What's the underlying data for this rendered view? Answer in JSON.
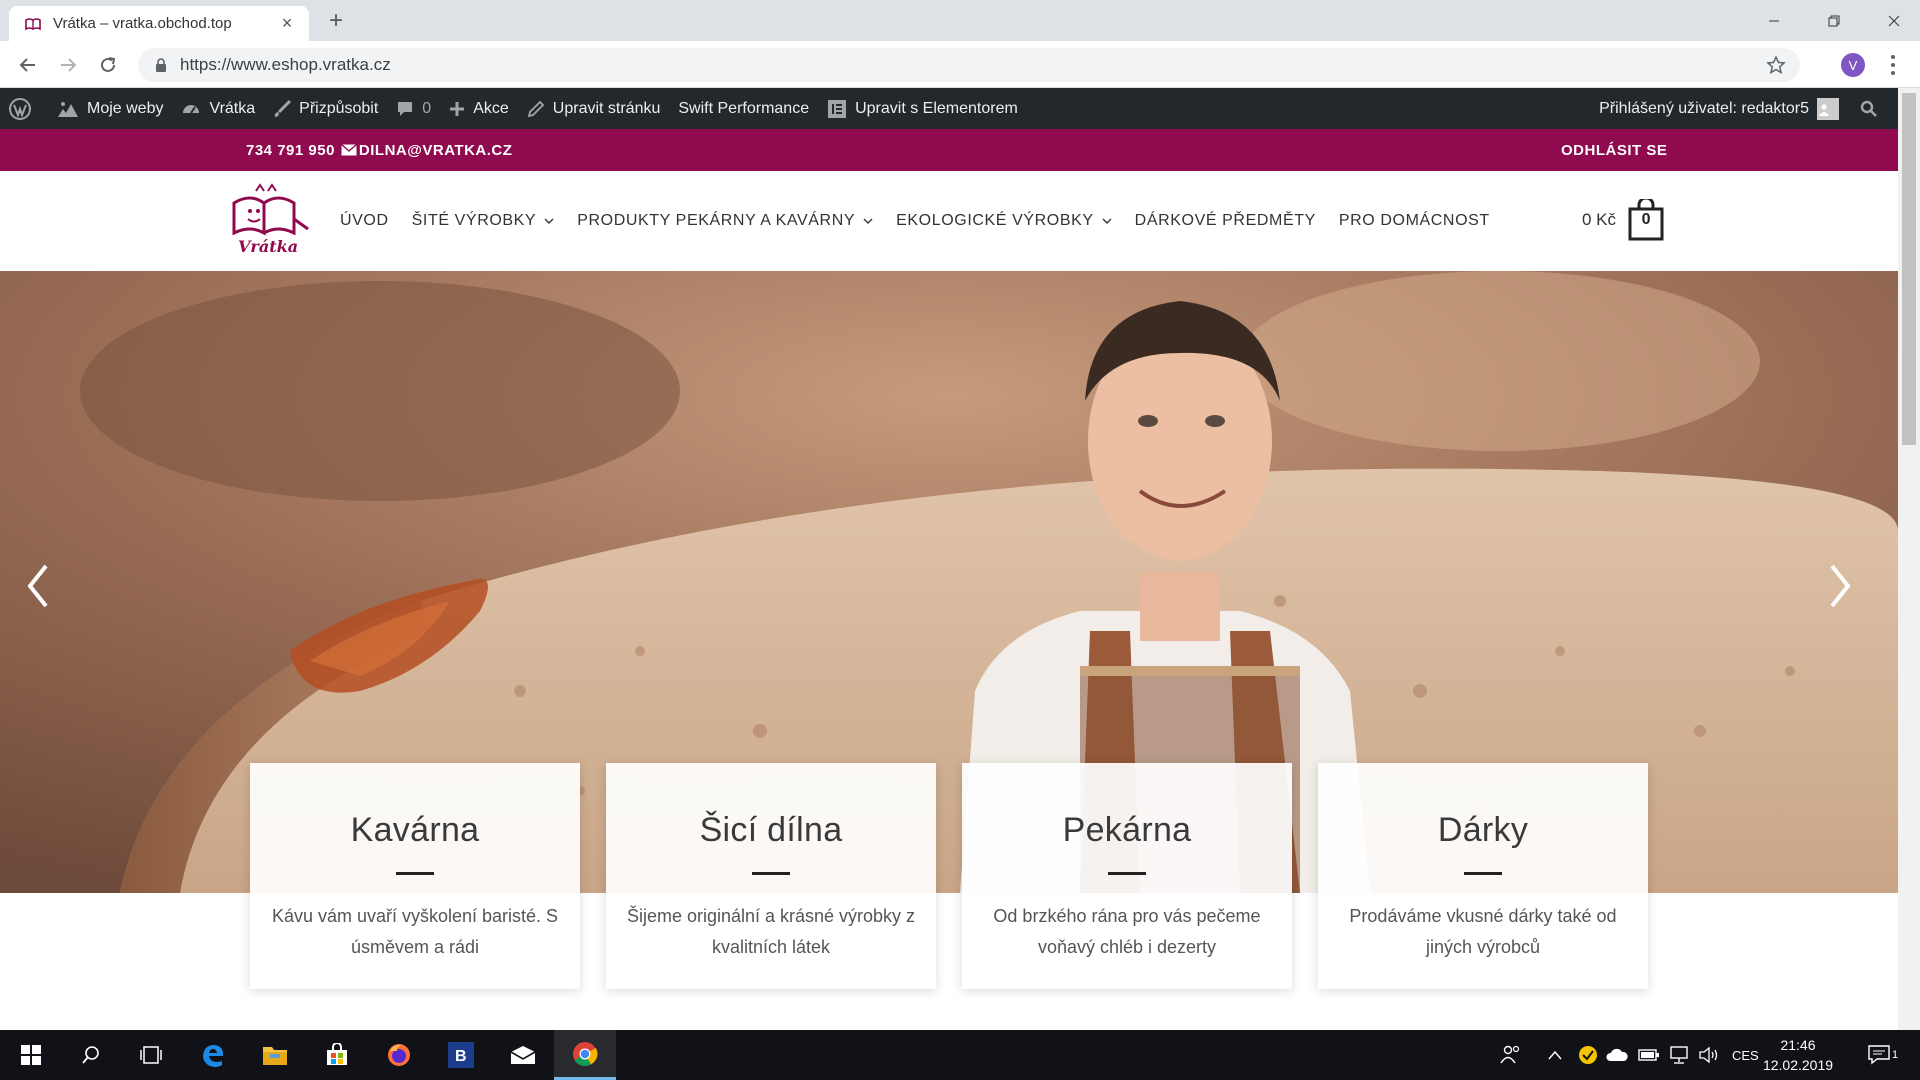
{
  "browser": {
    "tab_title": "Vrátka – vratka.obchod.top",
    "tab_close": "×",
    "new_tab": "+",
    "url": "https://www.eshop.vratka.cz",
    "profile_initial": "V"
  },
  "admin_bar": {
    "items": [
      {
        "label": "Moje weby",
        "icon": "sites-icon"
      },
      {
        "label": "Vrátka",
        "icon": "dashboard-icon"
      },
      {
        "label": "Přizpůsobit",
        "icon": "brush-icon"
      },
      {
        "label": "0",
        "icon": "comment-icon"
      },
      {
        "label": "Akce",
        "icon": "plus-icon"
      },
      {
        "label": "Upravit stránku",
        "icon": "pencil-icon"
      },
      {
        "label": "Swift Performance",
        "icon": ""
      },
      {
        "label": "Upravit s Elementorem",
        "icon": "elementor-icon"
      }
    ],
    "user": "Přihlášený uživatel: redaktor5"
  },
  "topbar": {
    "phone": "734 791 950",
    "email": "DILNA@VRATKA.CZ",
    "logout": "ODHLÁSIT SE",
    "color": "#8f0a4f"
  },
  "site": {
    "logo_text": "Vrátka",
    "nav": [
      {
        "label": "ÚVOD",
        "dropdown": false
      },
      {
        "label": "ŠITÉ VÝROBKY",
        "dropdown": true
      },
      {
        "label": "PRODUKTY PEKÁRNY A KAVÁRNY",
        "dropdown": true
      },
      {
        "label": "EKOLOGICKÉ VÝROBKY",
        "dropdown": true
      },
      {
        "label": "DÁRKOVÉ PŘEDMĚTY",
        "dropdown": false
      },
      {
        "label": "PRO DOMÁCNOST",
        "dropdown": false
      }
    ],
    "cart_amount": "0 Kč",
    "cart_count": "0"
  },
  "cards": [
    {
      "title": "Kavárna",
      "text": "Kávu vám uvaří vyškolení baristé. S úsměvem a rádi"
    },
    {
      "title": "Šicí dílna",
      "text": "Šijeme originální a krásné výrobky z kvalitních látek"
    },
    {
      "title": "Pekárna",
      "text": "Od brzkého rána pro vás pečeme voňavý chléb i dezerty"
    },
    {
      "title": "Dárky",
      "text": "Prodáváme vkusné dárky také od jiných výrobců"
    }
  ],
  "taskbar": {
    "language": "CES",
    "time": "21:46",
    "date": "12.02.2019",
    "notification_count": "1"
  }
}
